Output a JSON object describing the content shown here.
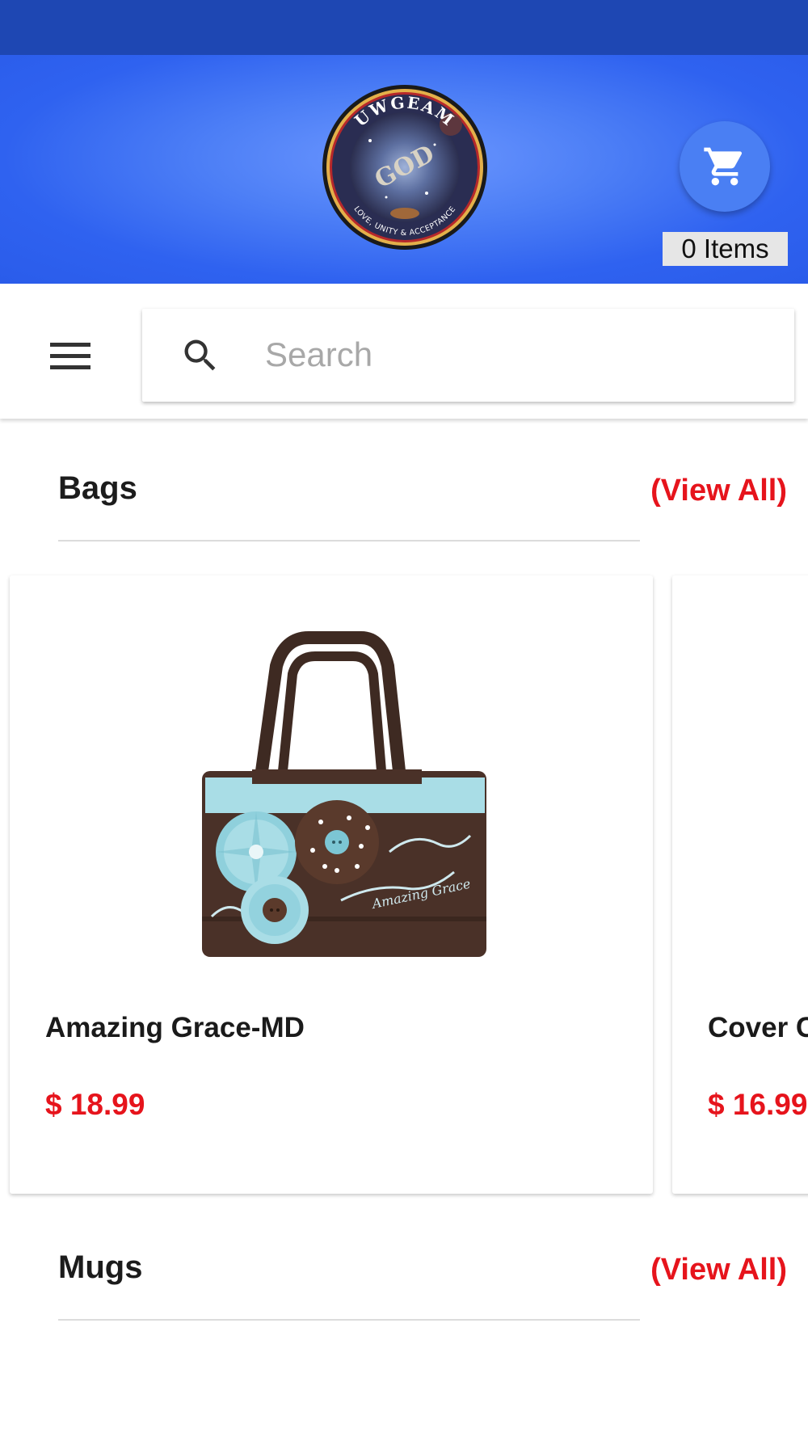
{
  "header": {
    "logo_text": "UWGEAM",
    "logo_center": "GOD",
    "logo_tagline": "LOVE, UNITY & ACCEPTANCE",
    "cart_count": "0 Items"
  },
  "search": {
    "placeholder": "Search"
  },
  "sections": [
    {
      "title": "Bags",
      "view_all": "(View All)",
      "products": [
        {
          "name": "Amazing Grace-MD",
          "price": "$ 18.99"
        },
        {
          "name": "Cover C",
          "price": "$ 16.99"
        }
      ]
    },
    {
      "title": "Mugs",
      "view_all": "(View All)"
    }
  ],
  "colors": {
    "header_blue": "#3366f0",
    "statusbar": "#1e47b3",
    "accent_red": "#e6141c",
    "bag_brown": "#4a3128",
    "bag_blue": "#a9dde6"
  },
  "icons": {
    "cart": "cart-icon",
    "menu": "menu-icon",
    "search": "search-icon"
  }
}
